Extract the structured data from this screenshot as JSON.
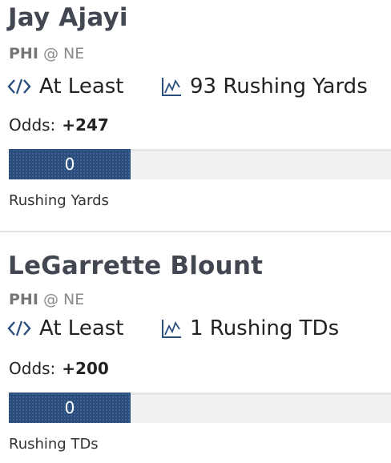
{
  "props": [
    {
      "player": "Jay Ajayi",
      "team": "PHI",
      "at": "@",
      "opponent": "NE",
      "type": "At Least",
      "target": "93 Rushing Yards",
      "odds_label": "Odds:",
      "odds": "+247",
      "progress_value": "0",
      "progress_fraction": 0,
      "stat_label": "Rushing Yards"
    },
    {
      "player": "LeGarrette Blount",
      "team": "PHI",
      "at": "@",
      "opponent": "NE",
      "type": "At Least",
      "target": "1 Rushing TDs",
      "odds_label": "Odds:",
      "odds": "+200",
      "progress_value": "0",
      "progress_fraction": 0,
      "stat_label": "Rushing TDs"
    }
  ],
  "icons": {
    "type": "code-icon",
    "target": "line-chart-icon"
  },
  "colors": {
    "fill": "#2a4d7f",
    "title": "#434751"
  }
}
